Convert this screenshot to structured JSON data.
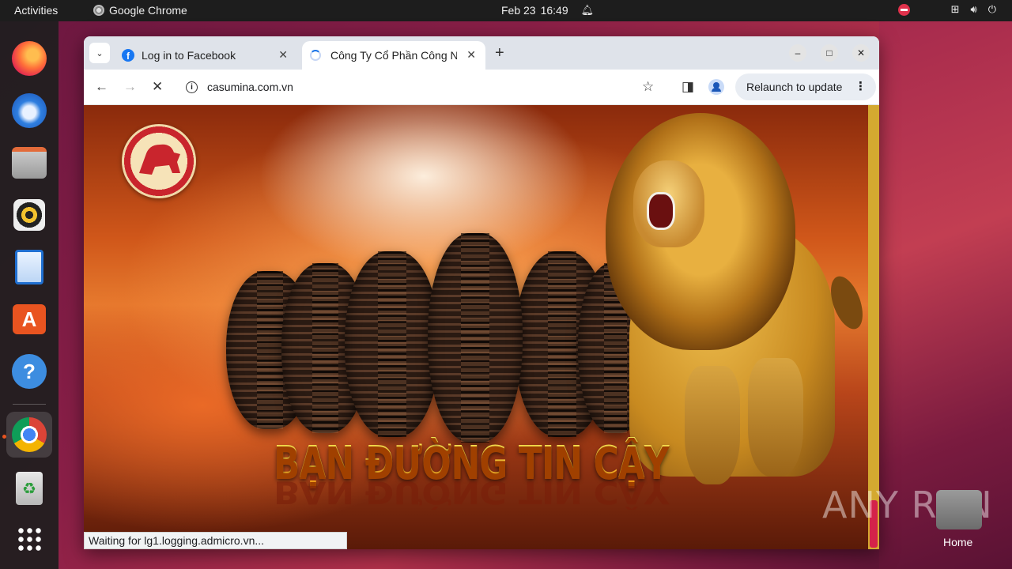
{
  "topbar": {
    "activities": "Activities",
    "app_name": "Google Chrome",
    "date": "Feb 23",
    "time": "16:49"
  },
  "dock": {
    "items": [
      "Firefox",
      "Thunderbird",
      "Files",
      "Rhythmbox",
      "LibreOffice Writer",
      "Ubuntu Software",
      "Help",
      "Google Chrome",
      "Trash",
      "Show Applications"
    ]
  },
  "browser": {
    "tabs": [
      {
        "title": "Log in to Facebook",
        "favicon": "facebook-icon"
      },
      {
        "title": "Công Ty Cổ Phần Công Nghiệp Cao Su Miền Nam",
        "favicon": "loading-spinner",
        "active": true
      }
    ],
    "url": "casumina.com.vn",
    "relaunch_label": "Relaunch to update",
    "status_text": "Waiting for lg1.logging.admicro.vn..."
  },
  "page": {
    "slogan": "BẠN ĐƯỜNG TIN CẬY"
  },
  "desktop": {
    "home_label": "Home",
    "watermark": "ANY RUN"
  },
  "colors": {
    "accent": "#e95420",
    "slogan": "#ffd21a",
    "chrome_tabstrip": "#dfe3ea"
  }
}
